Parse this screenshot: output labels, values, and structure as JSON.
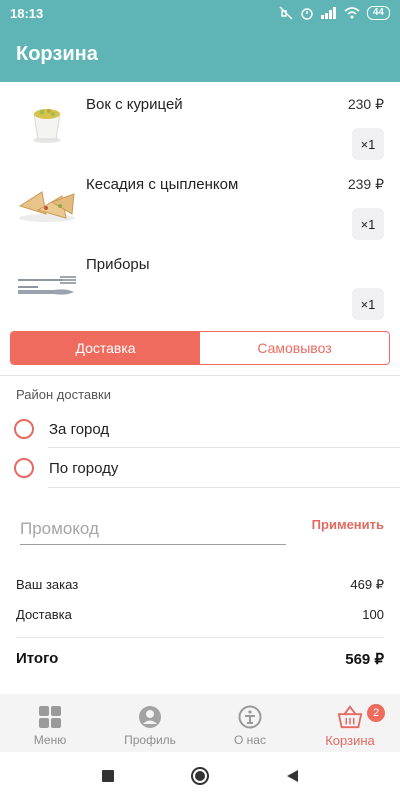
{
  "status_bar": {
    "time": "18:13",
    "battery": "44"
  },
  "app_bar": {
    "title": "Корзина"
  },
  "cart": {
    "items": [
      {
        "name": "Вок с курицей",
        "price": "230 ₽",
        "qty": "×1",
        "image": "wok-box-image"
      },
      {
        "name": "Кесадия с цыпленком",
        "price": "239 ₽",
        "qty": "×1",
        "image": "quesadilla-image"
      },
      {
        "name": "Приборы",
        "price": "",
        "qty": "×1",
        "image": "cutlery-image"
      }
    ]
  },
  "delivery_toggle": {
    "options": [
      "Доставка",
      "Самовывоз"
    ],
    "selected": "Доставка"
  },
  "delivery_area": {
    "label": "Район доставки",
    "options": [
      "За город",
      "По городу"
    ]
  },
  "promo": {
    "placeholder": "Промокод",
    "value": "",
    "apply_label": "Применить"
  },
  "summary": {
    "order_label": "Ваш заказ",
    "order_value": "469 ₽",
    "delivery_label": "Доставка",
    "delivery_value": "100",
    "total_label": "Итого",
    "total_value": "569 ₽"
  },
  "bottom_nav": {
    "items": [
      {
        "label": "Меню",
        "icon": "grid-icon"
      },
      {
        "label": "Профиль",
        "icon": "profile-icon"
      },
      {
        "label": "О нас",
        "icon": "info-icon"
      },
      {
        "label": "Корзина",
        "icon": "basket-icon"
      }
    ],
    "active": "Корзина",
    "cart_badge": "2"
  },
  "colors": {
    "accent": "#ee6b5e",
    "header": "#5fb5b5",
    "nav_inactive": "#8e8e8e"
  }
}
